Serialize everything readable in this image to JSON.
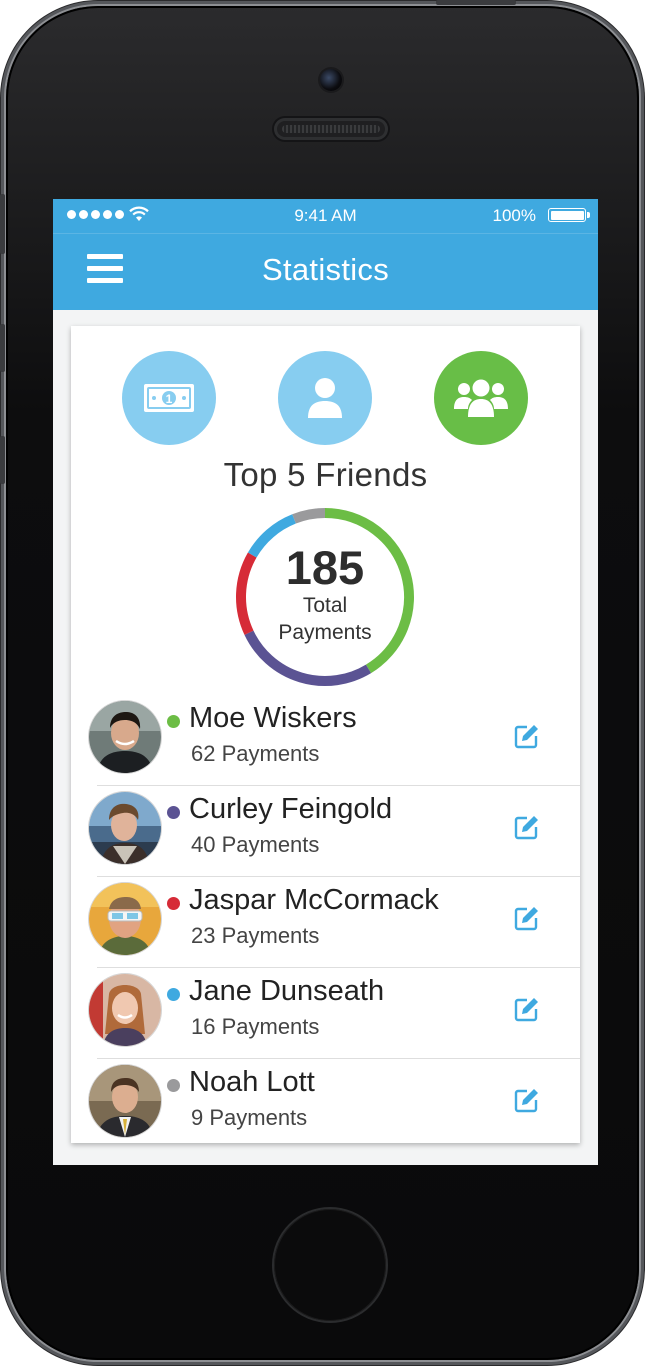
{
  "status_bar": {
    "time": "9:41 AM",
    "battery": "100%"
  },
  "nav": {
    "title": "Statistics"
  },
  "tabs": [
    {
      "name": "money",
      "icon": "money-bill-icon",
      "active": false
    },
    {
      "name": "person",
      "icon": "user-icon",
      "active": false
    },
    {
      "name": "friends",
      "icon": "users-group-icon",
      "active": true
    }
  ],
  "section": {
    "title": "Top 5 Friends"
  },
  "summary": {
    "total": "185",
    "total_label": "Total Payments"
  },
  "colors": {
    "accent": "#3fa9e0",
    "tab_inactive": "#87cdf0",
    "tab_active": "#68be47"
  },
  "friends": [
    {
      "name": "Moe Wiskers",
      "payments": "62 Payments",
      "count": 62,
      "color": "#6cbd45"
    },
    {
      "name": "Curley Feingold",
      "payments": "40 Payments",
      "count": 40,
      "color": "#5b5393"
    },
    {
      "name": "Jaspar McCormack",
      "payments": "23 Payments",
      "count": 23,
      "color": "#d62b37"
    },
    {
      "name": "Jane Dunseath",
      "payments": "16 Payments",
      "count": 16,
      "color": "#3fa9e0"
    },
    {
      "name": "Noah Lott",
      "payments": "9 Payments",
      "count": 9,
      "color": "#9a9a9c"
    }
  ],
  "chart_data": {
    "type": "pie",
    "categories": [
      "Moe Wiskers",
      "Curley Feingold",
      "Jaspar McCormack",
      "Jane Dunseath",
      "Noah Lott"
    ],
    "values": [
      62,
      40,
      23,
      16,
      9
    ],
    "title": "Top 5 Friends"
  }
}
